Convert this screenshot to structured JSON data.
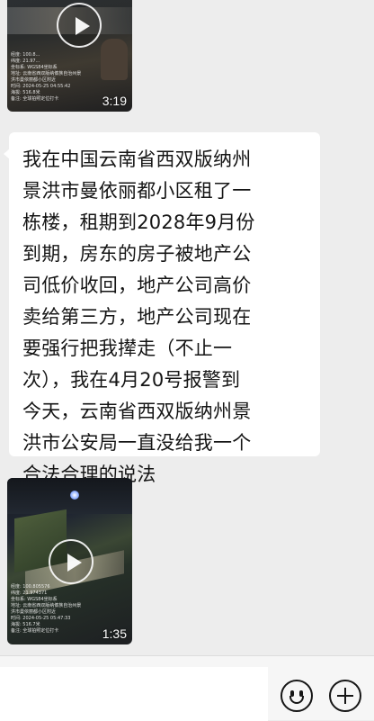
{
  "messages": [
    {
      "type": "video",
      "duration": "3:19",
      "watermark": [
        "经度: 100.8...",
        "纬度: 21.97...",
        "坐标系: WGS84坐标系",
        "地址: 云南省西双版纳傣族自治州景",
        "洪市曼依丽都小区附近",
        "时间: 2024-05-25 04:55:42",
        "海拔: 516.8米",
        "备注: 全球拍照定位打卡"
      ]
    },
    {
      "type": "text",
      "lines": [
        "我在中国云南省西双版纳州",
        "景洪市曼依丽都小区租了一",
        "栋楼，租期到2028年9月份",
        "到期，房东的房子被地产公",
        "司低价收回，地产公司高价",
        "卖给第三方，地产公司现在",
        "要强行把我撵走（不止一",
        "次），我在4月20号报警到",
        "今天，云南省西双版纳州景",
        "洪市公安局一直没给我一个",
        "合法合理的说法"
      ]
    },
    {
      "type": "video",
      "duration": "1:35",
      "watermark": [
        "经度: 100.805576",
        "纬度: 21.974371",
        "坐标系: WGS84坐标系",
        "地址: 云南省西双版纳傣族自治州景",
        "洪市曼依丽都小区附近",
        "时间: 2024-05-25 05:47:33",
        "海拔: 516.7米",
        "备注: 全球拍照定位打卡"
      ]
    }
  ],
  "input_bar": {
    "input_value": "",
    "emoji_icon": "emoji-icon",
    "plus_icon": "plus-icon"
  },
  "colors": {
    "chat_background": "#ededed",
    "bubble_background": "#ffffff",
    "text": "#151515"
  }
}
